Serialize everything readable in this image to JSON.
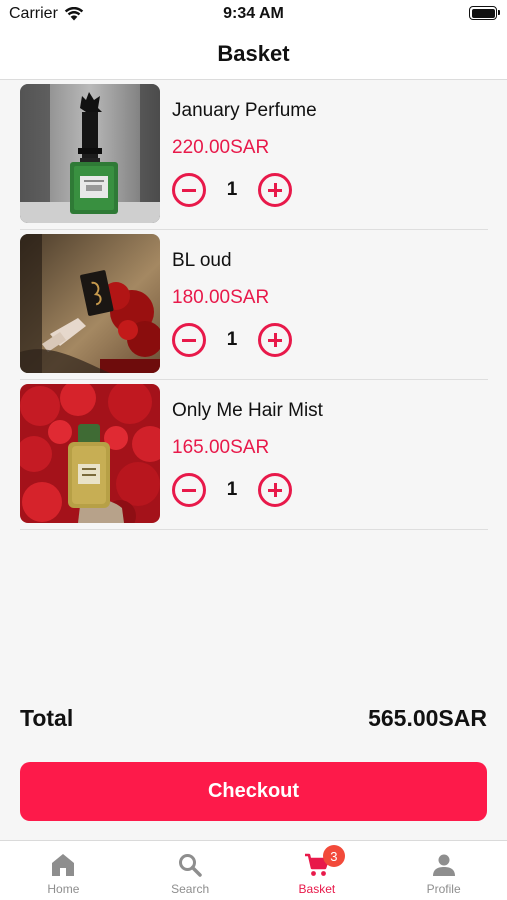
{
  "status_bar": {
    "carrier": "Carrier",
    "time": "9:34 AM"
  },
  "header": {
    "title": "Basket"
  },
  "basket": {
    "items": [
      {
        "name": "January Perfume",
        "price": "220.00SAR",
        "quantity": "1"
      },
      {
        "name": "BL oud",
        "price": "180.00SAR",
        "quantity": "1"
      },
      {
        "name": "Only Me Hair Mist",
        "price": "165.00SAR",
        "quantity": "1"
      }
    ]
  },
  "summary": {
    "total_label": "Total",
    "total_value": "565.00SAR"
  },
  "checkout": {
    "label": "Checkout"
  },
  "tabbar": {
    "items": [
      {
        "label": "Home",
        "icon": "home-icon"
      },
      {
        "label": "Search",
        "icon": "search-icon"
      },
      {
        "label": "Basket",
        "icon": "cart-icon",
        "badge": "3",
        "active": true
      },
      {
        "label": "Profile",
        "icon": "person-icon"
      }
    ]
  },
  "colors": {
    "accent": "#e8194a",
    "checkout_bg": "#fd1a4a",
    "badge_bg": "#f24a3a",
    "inactive": "#8e8e8e"
  }
}
